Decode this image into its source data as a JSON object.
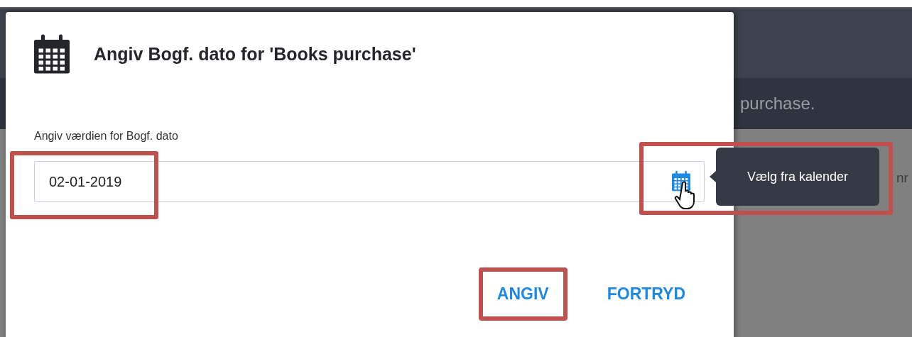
{
  "background": {
    "banner_text": "purchase.",
    "cut_text": "nr"
  },
  "dialog": {
    "title": "Angiv Bogf. dato for 'Books purchase'",
    "field": {
      "label": "Angiv værdien for Bogf. dato",
      "value": "02-01-2019",
      "highlighted": true
    },
    "buttons": [
      {
        "label": "ANGIV",
        "highlighted": true
      },
      {
        "label": "FORTRYD",
        "highlighted": false
      }
    ]
  },
  "tooltip": {
    "text": "Vælg fra kalender",
    "highlighted": true
  }
}
